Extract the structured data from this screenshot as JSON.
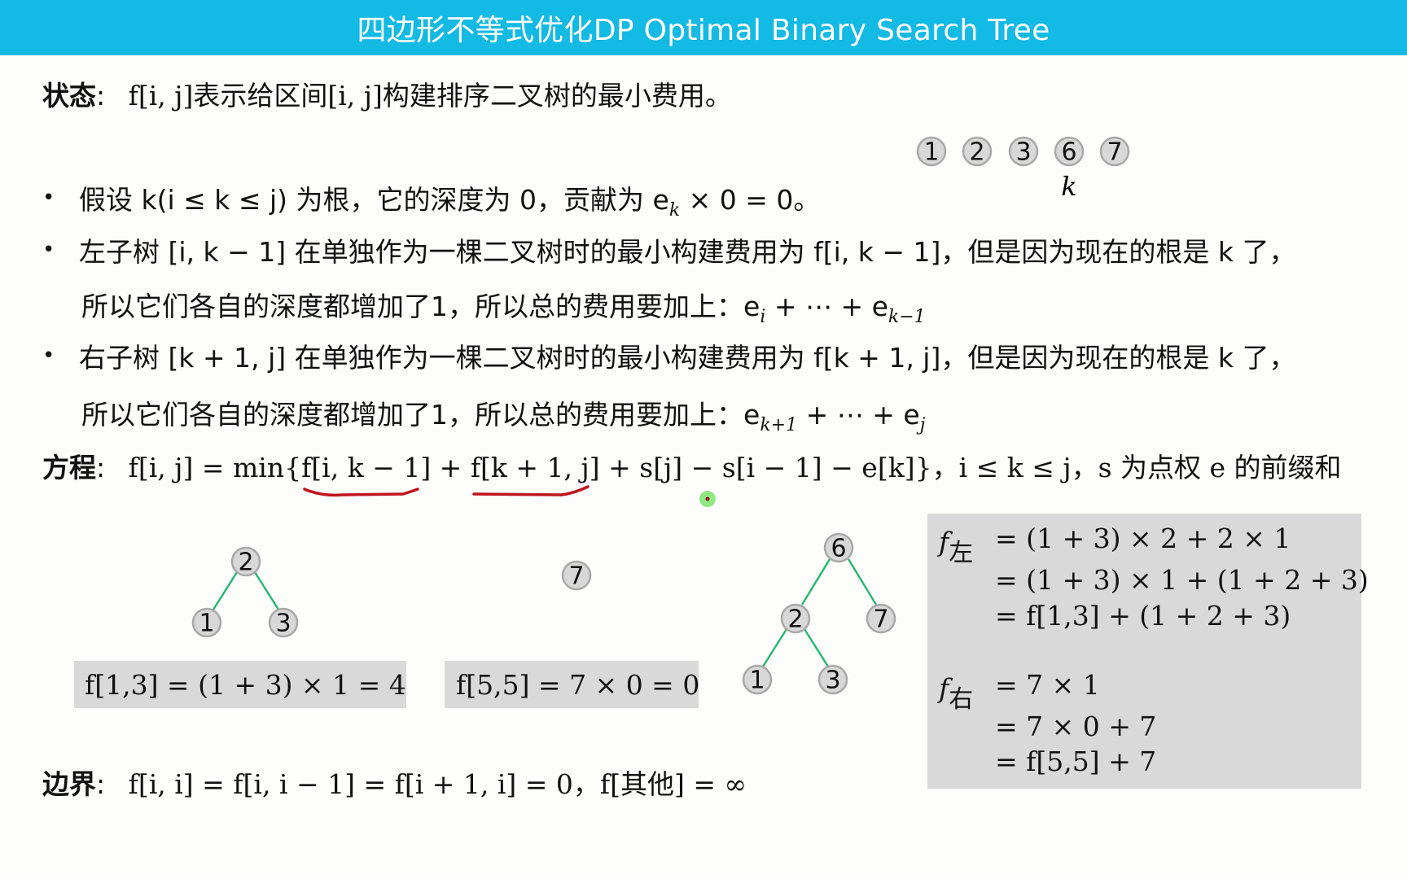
{
  "header": {
    "title": "四边形不等式优化DP Optimal Binary Search Tree"
  },
  "colors": {
    "header_bg": "#13bae4",
    "edge": "#2bb673",
    "underline": "#c0141e",
    "pointer": "#7ee36b",
    "panel": "#d9d9d9"
  },
  "state": {
    "label": "状态",
    "colon": ":",
    "text": "f[i, j]表示给区间[i, j]构建排序二叉树的最小费用。"
  },
  "top_nodes": {
    "values": [
      "1",
      "2",
      "3",
      "6",
      "7"
    ],
    "pointer_label": "k",
    "pointer_index": 3
  },
  "bullets": [
    {
      "text": "假设 k(i ≤ k ≤ j) 为根，它的深度为 0，贡献为 e",
      "sub": "k",
      "tail": " × 0 = 0。"
    },
    {
      "text": "左子树 [i, k − 1] 在单独作为一棵二叉树时的最小构建费用为 f[i, k − 1]，但是因为现在的根是 k 了，",
      "cont": "所以它们各自的深度都增加了1，所以总的费用要加上：e",
      "cont_sub1": "i",
      "cont_mid": " + ⋯ + e",
      "cont_sub2": "k−1"
    },
    {
      "text": "右子树 [k + 1, j] 在单独作为一棵二叉树时的最小构建费用为 f[k + 1, j]，但是因为现在的根是 k 了，",
      "cont": "所以它们各自的深度都增加了1，所以总的费用要加上：e",
      "cont_sub1": "k+1",
      "cont_mid": " + ⋯ + e",
      "cont_sub2": "j"
    }
  ],
  "equation": {
    "label": "方程",
    "colon": ":",
    "text": "f[i, j] = min{f[i, k − 1] + f[k + 1, j] + s[j] − s[i − 1] − e[k]}，i ≤ k ≤ j，s 为点权 e 的前缀和"
  },
  "trees": {
    "left_tree": {
      "root": "2",
      "left": "1",
      "right": "3"
    },
    "single_node": "7",
    "combined_tree": {
      "root": "6",
      "left": "2",
      "left_left": "1",
      "left_right": "3",
      "right": "7"
    }
  },
  "boxes": {
    "left_cost": "f[1,3] = (1 + 3) × 1 = 4",
    "right_cost": "f[5,5] = 7 × 0 = 0"
  },
  "panel": {
    "f_left_label": "f",
    "f_left_sub": "左",
    "f_left_lines": [
      "= (1 + 3) × 2 + 2 × 1",
      "= (1 + 3) × 1 + (1 + 2 + 3)",
      "= f[1,3] + (1 + 2 + 3)"
    ],
    "f_right_label": "f",
    "f_right_sub": "右",
    "f_right_lines": [
      "= 7 × 1",
      "= 7 × 0 + 7",
      "= f[5,5] + 7"
    ]
  },
  "boundary": {
    "label": "边界",
    "colon": ":",
    "text": "f[i, i] = f[i, i − 1] = f[i + 1, i] = 0，f[其他] = ∞"
  }
}
